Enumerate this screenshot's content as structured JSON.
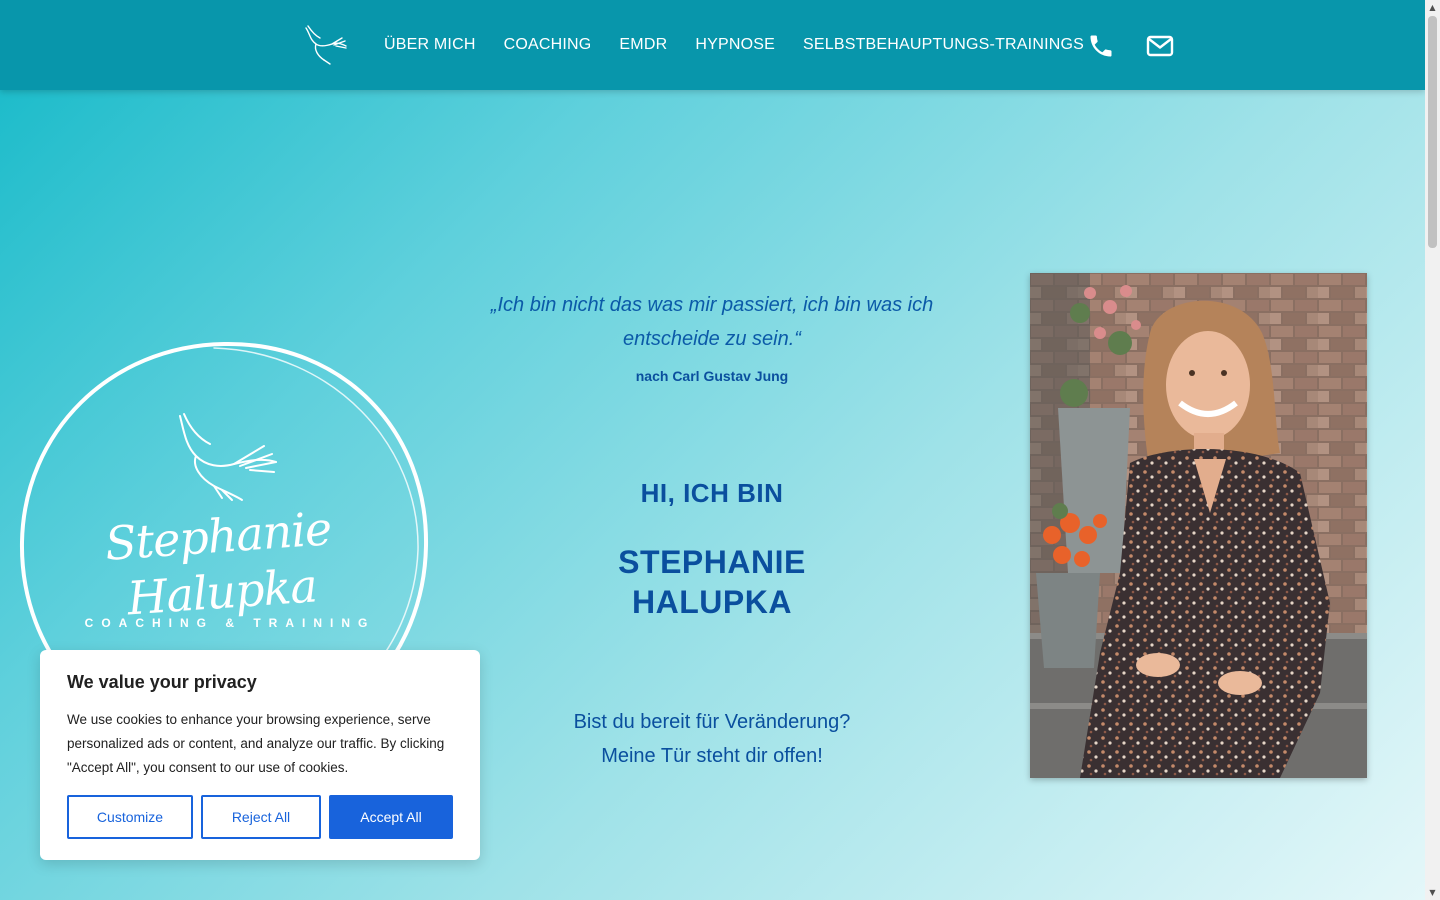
{
  "nav": {
    "items": [
      {
        "label": "ÜBER MICH"
      },
      {
        "label": "COACHING"
      },
      {
        "label": "EMDR"
      },
      {
        "label": "HYPNOSE"
      },
      {
        "label": "SELBSTBEHAUPTUNGS-TRAININGS"
      }
    ],
    "icons": [
      "bird-logo-icon",
      "phone-icon",
      "mail-icon"
    ]
  },
  "brand": {
    "name": "Stephanie Halupka",
    "tagline": "COACHING & TRAINING"
  },
  "hero": {
    "quote": "„Ich bin nicht das was mir passiert, ich bin was ich entscheide zu sein.“",
    "quote_author": "nach Carl Gustav Jung",
    "greeting": "HI, ICH BIN",
    "name_line1": "STEPHANIE",
    "name_line2": "HALUPKA",
    "tagline_line1": "Bist du bereit für Veränderung?",
    "tagline_line2": "Meine Tür steht dir offen!"
  },
  "cookie": {
    "title": "We value your privacy",
    "text": "We use cookies to enhance your browsing experience, serve personalized ads or content, and analyze our traffic. By clicking \"Accept All\", you consent to our use of cookies.",
    "customize": "Customize",
    "reject": "Reject All",
    "accept": "Accept All"
  },
  "colors": {
    "header": "#0896ab",
    "heading_text": "#0a4f9e",
    "accent_button": "#1863dc"
  }
}
